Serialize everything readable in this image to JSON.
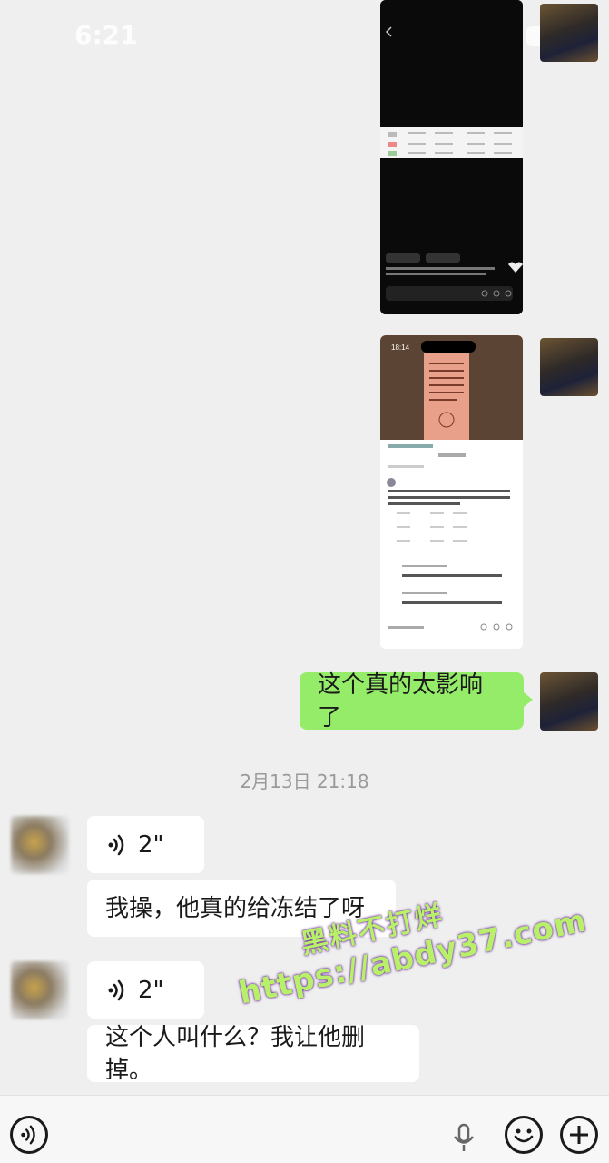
{
  "status_bar": {
    "time": "6:21"
  },
  "screenshot_2": {
    "clock": "18:14"
  },
  "messages": {
    "outgoing_text": "这个真的太影响了",
    "timestamp": "2月13日 21:18",
    "voice_1_duration": "2\"",
    "text_1": "我操，他真的给冻结了呀",
    "voice_2_duration": "2\"",
    "text_2": "这个人叫什么？我让他删掉。"
  },
  "watermark": {
    "line1": "黑料不打烊",
    "line2": "https://abdy37.com"
  },
  "icons": {
    "voice_message": "voice-wave-icon",
    "voice_input": "voice-mode-icon",
    "mic": "microphone-icon",
    "emoji": "emoji-icon",
    "more": "plus-icon"
  },
  "colors": {
    "outgoing_bubble": "#95ec69",
    "incoming_bubble": "#ffffff",
    "background": "#efefef"
  }
}
